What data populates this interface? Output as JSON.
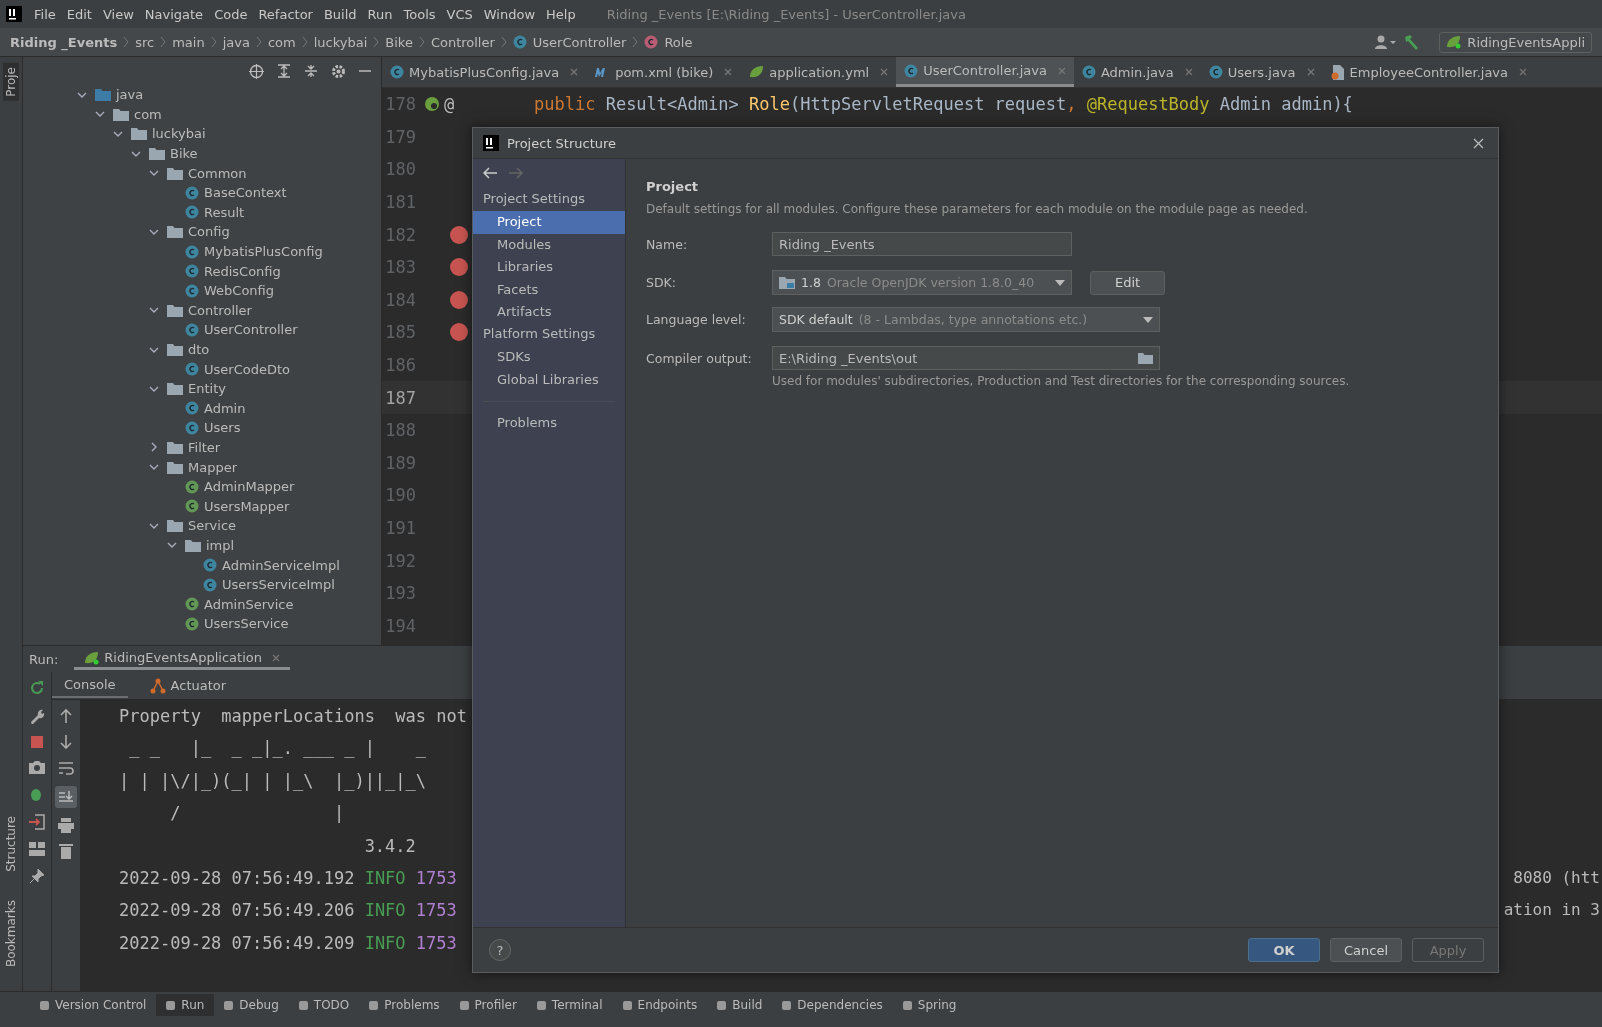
{
  "menu": [
    "File",
    "Edit",
    "View",
    "Navigate",
    "Code",
    "Refactor",
    "Build",
    "Run",
    "Tools",
    "VCS",
    "Window",
    "Help"
  ],
  "window_title": "Riding _Events [E:\\Riding _Events] - UserController.java",
  "breadcrumb": [
    {
      "label": "Riding _Events",
      "kind": "project"
    },
    {
      "label": "src",
      "kind": "dir"
    },
    {
      "label": "main",
      "kind": "dir"
    },
    {
      "label": "java",
      "kind": "dir"
    },
    {
      "label": "com",
      "kind": "dir"
    },
    {
      "label": "luckybai",
      "kind": "dir"
    },
    {
      "label": "Bike",
      "kind": "dir"
    },
    {
      "label": "Controller",
      "kind": "dir"
    },
    {
      "label": "UserController",
      "kind": "class"
    },
    {
      "label": "Role",
      "kind": "method"
    }
  ],
  "run_config": "RidingEventsAppli",
  "side_tools": [
    {
      "label": "Proje",
      "selected": true
    },
    {
      "label": "Structure",
      "selected": false
    },
    {
      "label": "Bookmarks",
      "selected": false
    }
  ],
  "tree": [
    {
      "label": "java",
      "kind": "source",
      "expanded": true,
      "children": [
        {
          "label": "com",
          "kind": "folder",
          "expanded": true,
          "children": [
            {
              "label": "luckybai",
              "kind": "folder",
              "expanded": true,
              "children": [
                {
                  "label": "Bike",
                  "kind": "folder",
                  "expanded": true,
                  "children": [
                    {
                      "label": "Common",
                      "kind": "folder",
                      "expanded": true,
                      "children": [
                        {
                          "label": "BaseContext",
                          "kind": "class"
                        },
                        {
                          "label": "Result",
                          "kind": "class"
                        }
                      ]
                    },
                    {
                      "label": "Config",
                      "kind": "folder",
                      "expanded": true,
                      "children": [
                        {
                          "label": "MybatisPlusConfig",
                          "kind": "class"
                        },
                        {
                          "label": "RedisConfig",
                          "kind": "class"
                        },
                        {
                          "label": "WebConfig",
                          "kind": "class"
                        }
                      ]
                    },
                    {
                      "label": "Controller",
                      "kind": "folder",
                      "expanded": true,
                      "children": [
                        {
                          "label": "UserController",
                          "kind": "class"
                        }
                      ]
                    },
                    {
                      "label": "dto",
                      "kind": "folder",
                      "expanded": true,
                      "children": [
                        {
                          "label": "UserCodeDto",
                          "kind": "class"
                        }
                      ]
                    },
                    {
                      "label": "Entity",
                      "kind": "folder",
                      "expanded": true,
                      "children": [
                        {
                          "label": "Admin",
                          "kind": "class"
                        },
                        {
                          "label": "Users",
                          "kind": "class"
                        }
                      ]
                    },
                    {
                      "label": "Filter",
                      "kind": "folder",
                      "expanded": false
                    },
                    {
                      "label": "Mapper",
                      "kind": "folder",
                      "expanded": true,
                      "children": [
                        {
                          "label": "AdminMapper",
                          "kind": "interface"
                        },
                        {
                          "label": "UsersMapper",
                          "kind": "interface"
                        }
                      ]
                    },
                    {
                      "label": "Service",
                      "kind": "folder",
                      "expanded": true,
                      "children": [
                        {
                          "label": "impl",
                          "kind": "folder",
                          "expanded": true,
                          "children": [
                            {
                              "label": "AdminServiceImpl",
                              "kind": "class"
                            },
                            {
                              "label": "UsersServiceImpl",
                              "kind": "class"
                            }
                          ]
                        },
                        {
                          "label": "AdminService",
                          "kind": "interface"
                        },
                        {
                          "label": "UsersService",
                          "kind": "interface"
                        }
                      ]
                    }
                  ]
                }
              ]
            }
          ]
        }
      ]
    }
  ],
  "editor_tabs": [
    {
      "label": "MybatisPlusConfig.java",
      "kind": "class",
      "selected": false
    },
    {
      "label": "pom.xml (bike)",
      "kind": "maven",
      "selected": false
    },
    {
      "label": "application.yml",
      "kind": "yml",
      "selected": false
    },
    {
      "label": "UserController.java",
      "kind": "class",
      "selected": true
    },
    {
      "label": "Admin.java",
      "kind": "class",
      "selected": false
    },
    {
      "label": "Users.java",
      "kind": "class",
      "selected": false
    },
    {
      "label": "EmployeeController.java",
      "kind": "java",
      "selected": false
    }
  ],
  "code_lines": [
    {
      "number": "178",
      "bean_marker": true,
      "gutter_text": "@",
      "breakpoint": false,
      "current": false,
      "tokens": [
        {
          "text": "public ",
          "kind": "keyword"
        },
        {
          "text": "Result<Admin> ",
          "kind": "plain"
        },
        {
          "text": "Role",
          "kind": "method"
        },
        {
          "text": "(HttpServletRequest request",
          "kind": "plain"
        },
        {
          "text": ", ",
          "kind": "keyword"
        },
        {
          "text": "@RequestBody ",
          "kind": "annotation"
        },
        {
          "text": "Admin admin){",
          "kind": "plain"
        }
      ]
    },
    {
      "number": "179",
      "breakpoint": false,
      "current": false
    },
    {
      "number": "180",
      "breakpoint": false,
      "current": false
    },
    {
      "number": "181",
      "breakpoint": false,
      "current": false
    },
    {
      "number": "182",
      "breakpoint": true,
      "current": false
    },
    {
      "number": "183",
      "breakpoint": true,
      "current": false
    },
    {
      "number": "184",
      "breakpoint": true,
      "current": false
    },
    {
      "number": "185",
      "breakpoint": true,
      "current": false
    },
    {
      "number": "186",
      "breakpoint": false,
      "current": false
    },
    {
      "number": "187",
      "breakpoint": false,
      "current": true
    },
    {
      "number": "188",
      "breakpoint": false,
      "current": false
    },
    {
      "number": "189",
      "breakpoint": false,
      "current": false
    },
    {
      "number": "190",
      "breakpoint": false,
      "current": false
    },
    {
      "number": "191",
      "breakpoint": false,
      "current": false
    },
    {
      "number": "192",
      "breakpoint": false,
      "current": false
    },
    {
      "number": "193",
      "breakpoint": false,
      "current": false
    },
    {
      "number": "194",
      "breakpoint": false,
      "current": false
    }
  ],
  "run": {
    "label": "Run:",
    "tab": "RidingEventsApplication",
    "subtabs": [
      {
        "label": "Console",
        "kind": "console",
        "selected": true
      },
      {
        "label": "Actuator",
        "kind": "actuator",
        "selected": false
      }
    ],
    "banner": [
      "Property  mapperLocations  was not",
      " _ _   |_  _ _|_. ___ _ |    _",
      "| | |\\/|_)(_| | |_\\  |_)||_|_\\",
      "     /               |",
      "                        3.4.2"
    ],
    "log": [
      {
        "time": "2022-09-28 07:56:49.192",
        "level": "INFO",
        "pid": "1753",
        "tail": "8080 (htt"
      },
      {
        "time": "2022-09-28 07:56:49.206",
        "level": "INFO",
        "pid": "1753",
        "tail": "ation in 3"
      },
      {
        "time": "2022-09-28 07:56:49.209",
        "level": "INFO",
        "pid": "1753"
      }
    ]
  },
  "bottom_tools": [
    {
      "label": "Version Control",
      "selected": false
    },
    {
      "label": "Run",
      "selected": true
    },
    {
      "label": "Debug",
      "selected": false
    },
    {
      "label": "TODO",
      "selected": false
    },
    {
      "label": "Problems",
      "selected": false
    },
    {
      "label": "Profiler",
      "selected": false
    },
    {
      "label": "Terminal",
      "selected": false
    },
    {
      "label": "Endpoints",
      "selected": false
    },
    {
      "label": "Build",
      "selected": false
    },
    {
      "label": "Dependencies",
      "selected": false
    },
    {
      "label": "Spring",
      "selected": false
    }
  ],
  "dialog": {
    "title": "Project Structure",
    "nav": [
      {
        "label": "Project Settings",
        "kind": "section"
      },
      {
        "label": "Project",
        "kind": "item",
        "selected": true
      },
      {
        "label": "Modules",
        "kind": "item",
        "selected": false
      },
      {
        "label": "Libraries",
        "kind": "item",
        "selected": false
      },
      {
        "label": "Facets",
        "kind": "item",
        "selected": false
      },
      {
        "label": "Artifacts",
        "kind": "item",
        "selected": false
      },
      {
        "label": "Platform Settings",
        "kind": "section"
      },
      {
        "label": "SDKs",
        "kind": "item",
        "selected": false
      },
      {
        "label": "Global Libraries",
        "kind": "item",
        "selected": false
      },
      {
        "label": "Problems",
        "kind": "item",
        "selected": false,
        "separated": true
      }
    ],
    "heading": "Project",
    "description": "Default settings for all modules. Configure these parameters for each module on the module page as needed.",
    "name": {
      "label": "Name:",
      "value": "Riding _Events"
    },
    "sdk": {
      "label": "SDK:",
      "version": "1.8",
      "detail": "Oracle OpenJDK version 1.8.0_40",
      "button": "Edit"
    },
    "language_level": {
      "label": "Language level:",
      "value": "SDK default",
      "detail": "(8 - Lambdas, type annotations etc.)"
    },
    "compiler_output": {
      "label": "Compiler output:",
      "value": "E:\\Riding _Events\\out",
      "note": "Used for modules' subdirectories, Production and Test directories for the corresponding sources."
    },
    "help": "?",
    "buttons": [
      {
        "label": "OK",
        "kind": "primary",
        "disabled": false
      },
      {
        "label": "Cancel",
        "kind": "normal",
        "disabled": false
      },
      {
        "label": "Apply",
        "kind": "normal",
        "disabled": true
      }
    ]
  }
}
